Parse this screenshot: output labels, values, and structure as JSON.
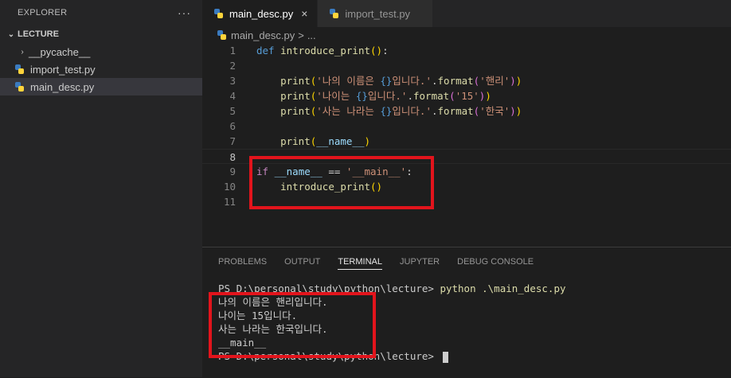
{
  "explorer": {
    "title": "EXPLORER",
    "more": "···",
    "folder": "LECTURE",
    "items": [
      {
        "name": "__pycache__",
        "type": "folder"
      },
      {
        "name": "import_test.py",
        "type": "python"
      },
      {
        "name": "main_desc.py",
        "type": "python"
      }
    ]
  },
  "tabs": [
    {
      "label": "main_desc.py",
      "active": true,
      "close": "×"
    },
    {
      "label": "import_test.py",
      "active": false
    }
  ],
  "breadcrumb": {
    "file": "main_desc.py",
    "sep": ">",
    "rest": "..."
  },
  "code": {
    "line_numbers": [
      "1",
      "2",
      "3",
      "4",
      "5",
      "6",
      "7",
      "8",
      "9",
      "10",
      "11"
    ],
    "lines": [
      "def introduce_print():",
      "",
      "    print('나의 이름은 {}입니다.'.format('핸리'))",
      "    print('나이는 {}입니다.'.format('15'))",
      "    print('사는 나라는 {}입니다.'.format('한국'))",
      "",
      "    print(__name__)",
      "",
      "if __name__ == '__main__':",
      "    introduce_print()",
      ""
    ]
  },
  "panel": {
    "tabs": [
      "PROBLEMS",
      "OUTPUT",
      "TERMINAL",
      "JUPYTER",
      "DEBUG CONSOLE"
    ],
    "active_tab": "TERMINAL"
  },
  "terminal": {
    "prompt1": "PS D:\\personal\\study\\python\\lecture> ",
    "command": "python .\\main_desc.py",
    "output": [
      "나의 이름은 핸리입니다.",
      "나이는 15입니다.",
      "사는 나라는 한국입니다.",
      "__main__"
    ],
    "prompt2": "PS D:\\personal\\study\\python\\lecture> "
  },
  "colors": {
    "highlight_box": "#e2141c",
    "accent": "#007acc"
  }
}
